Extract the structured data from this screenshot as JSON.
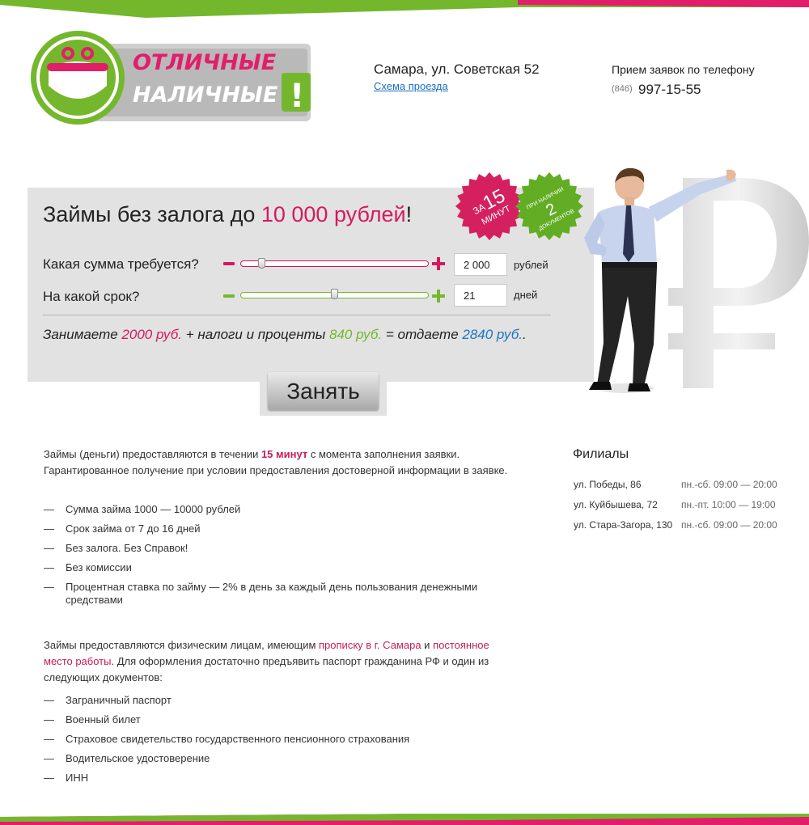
{
  "brand": {
    "logo_line1": "ОТЛИЧНЫЕ",
    "logo_line2": "НАЛИЧНЫЕ",
    "logo_mark": "!"
  },
  "header": {
    "city_address": "Самара, ул. Советская 52",
    "map_link": "Схема проезда",
    "phone_label": "Прием заявок по телефону",
    "phone_code": "(846)",
    "phone_number": "997-15-55"
  },
  "calculator": {
    "title_prefix": "Займы без залога до ",
    "title_highlight": "10 000 рублей",
    "title_suffix": "!",
    "amount_question": "Какая сумма требуется?",
    "amount_value": "2 000",
    "amount_unit": "рублей",
    "amount_fraction": 0.1,
    "term_question": "На какой срок?",
    "term_value": "21",
    "term_unit": "дней",
    "term_fraction": 0.5,
    "summary": {
      "part1": "Занимаете ",
      "borrow": "2000 руб.",
      "part2": " + налоги и проценты ",
      "interest": "840 руб.",
      "part3": " = отдаете ",
      "total": "2840 руб.",
      "part4": "."
    },
    "submit_label": "Занять"
  },
  "badges": {
    "speed_top": "ЗА",
    "speed_num": "15",
    "speed_bottom": "МИНУТ",
    "docs_top": "ПРИ НАЛИЧИИ",
    "docs_num": "2",
    "docs_bottom": "ДОКУМЕНТОВ"
  },
  "intro": {
    "before": "Займы (деньги) предоставляются в течении ",
    "strong": "15 минут",
    "after": " с момента заполнения заявки. Гарантированное получение при условии предоставления достоверной информации в заявке."
  },
  "conditions": [
    "Сумма займа 1000 — 10000 рублей",
    "Срок займа от 7 до 16 дней",
    "Без залога. Без Справок!",
    "Без комиссии",
    "Процентная ставка по займу — 2% в день за каждый день пользования денежными средствами"
  ],
  "requirements": {
    "p1": "Займы предоставляются физическим лицам, имеющим ",
    "link1": "прописку в г. Самара",
    "p2": " и ",
    "link2": "постоянное место работы",
    "p3": ". Для оформления достаточно предъявить паспорт гражданина РФ и один из следующих документов:"
  },
  "documents": [
    "Заграничный паспорт",
    "Военный билет",
    "Страховое свидетельство государственного пенсионного страхования",
    "Водительское удостоверение",
    "ИНН"
  ],
  "branches": {
    "title": "Филиалы",
    "items": [
      {
        "address": "ул. Победы, 86",
        "hours": "пн.-сб. 09:00 — 20:00"
      },
      {
        "address": "ул. Куйбышева, 72",
        "hours": "пн.-пт. 10:00 — 19:00"
      },
      {
        "address": "ул. Стара-Загора, 130",
        "hours": "пн.-сб. 09:00 — 20:00"
      }
    ]
  },
  "dash": "—",
  "colors": {
    "pink": "#d6195f",
    "green": "#74b72d",
    "blue": "#1c75c4",
    "panel": "#e2e2e2"
  }
}
